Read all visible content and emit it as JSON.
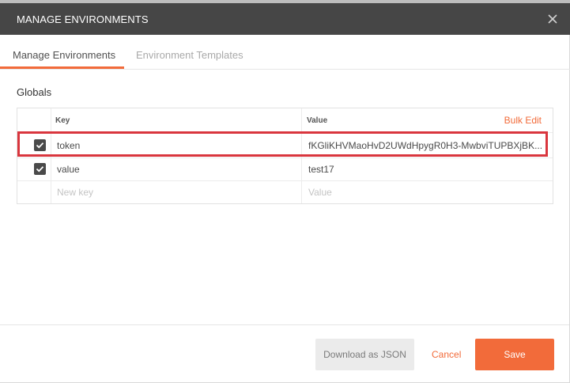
{
  "header": {
    "title": "MANAGE ENVIRONMENTS",
    "close_icon": "close-icon"
  },
  "tabs": [
    {
      "label": "Manage Environments",
      "active": true
    },
    {
      "label": "Environment Templates",
      "active": false
    }
  ],
  "globals": {
    "title": "Globals",
    "columns": {
      "key": "Key",
      "value": "Value"
    },
    "bulk_edit_label": "Bulk Edit",
    "rows": [
      {
        "checked": true,
        "key": "token",
        "value": "fKGliKHVMaoHvD2UWdHpygR0H3-MwbviTUPBXjBK..."
      },
      {
        "checked": true,
        "key": "value",
        "value": "test17"
      }
    ],
    "new_row": {
      "key_placeholder": "New key",
      "value_placeholder": "Value"
    }
  },
  "footer": {
    "download_label": "Download as JSON",
    "cancel_label": "Cancel",
    "save_label": "Save"
  },
  "colors": {
    "accent": "#f26b3a",
    "header_bg": "#464646",
    "highlight": "#d9363e"
  }
}
